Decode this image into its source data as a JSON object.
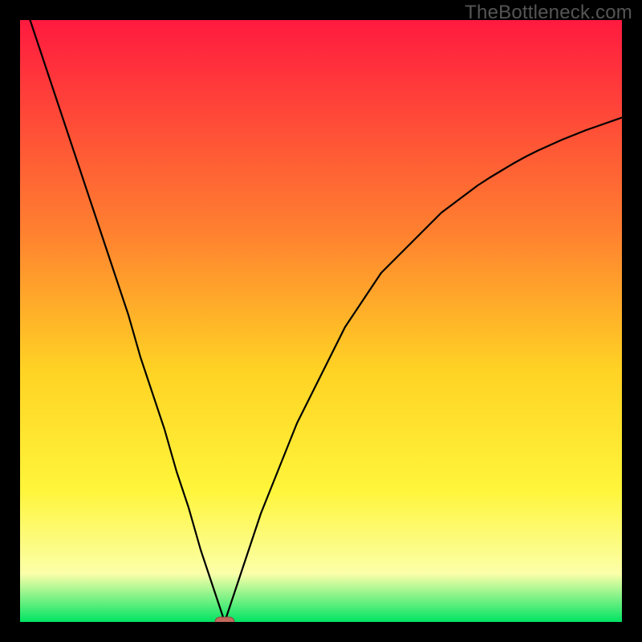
{
  "watermark": "TheBottleneck.com",
  "colors": {
    "frame": "#000000",
    "curve": "#000000",
    "marker_fill": "#c1695c",
    "marker_stroke": "#8a4a41",
    "grad_top": "#ff1a3f",
    "grad_mid1": "#ff8030",
    "grad_mid2": "#ffd224",
    "grad_mid3": "#fff53a",
    "grad_mid4": "#fbffa9",
    "grad_bottom": "#00e463"
  },
  "chart_data": {
    "type": "line",
    "title": "",
    "xlabel": "",
    "ylabel": "",
    "xlim": [
      0,
      100
    ],
    "ylim": [
      0,
      100
    ],
    "min_marker": {
      "x": 34,
      "y": 0
    },
    "series": [
      {
        "name": "bottleneck-curve",
        "x": [
          0,
          2,
          4,
          6,
          8,
          10,
          12,
          14,
          16,
          18,
          20,
          22,
          24,
          26,
          28,
          30,
          31,
          32,
          33,
          34,
          35,
          36,
          37,
          38,
          40,
          42,
          44,
          46,
          48,
          50,
          52,
          54,
          56,
          58,
          60,
          62,
          64,
          66,
          68,
          70,
          72,
          74,
          76,
          78,
          80,
          82,
          84,
          86,
          88,
          90,
          92,
          94,
          96,
          98,
          100
        ],
        "values": [
          105,
          99,
          93,
          87,
          81,
          75,
          69,
          63,
          57,
          51,
          44,
          38,
          32,
          25,
          19,
          12,
          9,
          6,
          3,
          0,
          3,
          6,
          9,
          12,
          18,
          23,
          28,
          33,
          37,
          41,
          45,
          49,
          52,
          55,
          58,
          60,
          62,
          64,
          66,
          68,
          69.5,
          71,
          72.5,
          73.8,
          75,
          76.2,
          77.3,
          78.3,
          79.2,
          80.1,
          80.9,
          81.7,
          82.4,
          83.1,
          83.8
        ]
      }
    ]
  }
}
